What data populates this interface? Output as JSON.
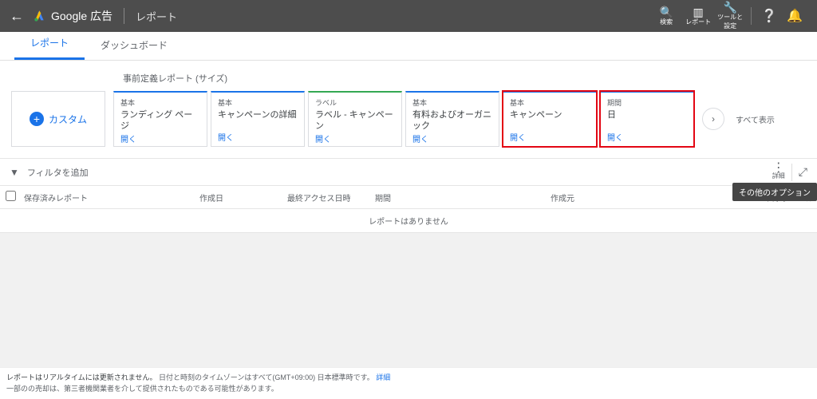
{
  "header": {
    "brand": "Google 広告",
    "section": "レポート",
    "tools": {
      "search": "検索",
      "reports": "レポート",
      "tools": "ツールと\n設定"
    }
  },
  "tabs": {
    "reports": "レポート",
    "dashboards": "ダッシュボード"
  },
  "strip": {
    "title": "事前定義レポート (サイズ)",
    "custom": "カスタム",
    "show_all": "すべて表示",
    "open": "開く",
    "cards": [
      {
        "cat": "基本",
        "name": "ランディング ページ",
        "top": "blue"
      },
      {
        "cat": "基本",
        "name": "キャンペーンの詳細",
        "top": "blue"
      },
      {
        "cat": "ラベル",
        "name": "ラベル - キャンペーン",
        "top": "green"
      },
      {
        "cat": "基本",
        "name": "有料およびオーガニック",
        "top": "blue"
      },
      {
        "cat": "基本",
        "name": "キャンペーン",
        "top": "blue",
        "hl": true
      },
      {
        "cat": "期間",
        "name": "日",
        "top": "blue",
        "hl": true
      }
    ]
  },
  "filters": {
    "add": "フィルタを追加",
    "more_label": "詳細",
    "tooltip": "その他のオプション"
  },
  "table": {
    "cols": {
      "name": "保存済みレポート",
      "created": "作成日",
      "accessed": "最終アクセス日時",
      "range": "期間",
      "creator": "作成元",
      "schedule": "スケジュール"
    },
    "empty": "レポートはありません"
  },
  "footer": {
    "bold": "レポートはリアルタイムには更新されません。",
    "rest": "日付と時刻のタイムゾーンはすべて(GMT+09:00) 日本標準時です。",
    "link": "詳細",
    "line2": "一部のの売却は、第三者機関業者を介して提供されたものである可能性があります。"
  }
}
